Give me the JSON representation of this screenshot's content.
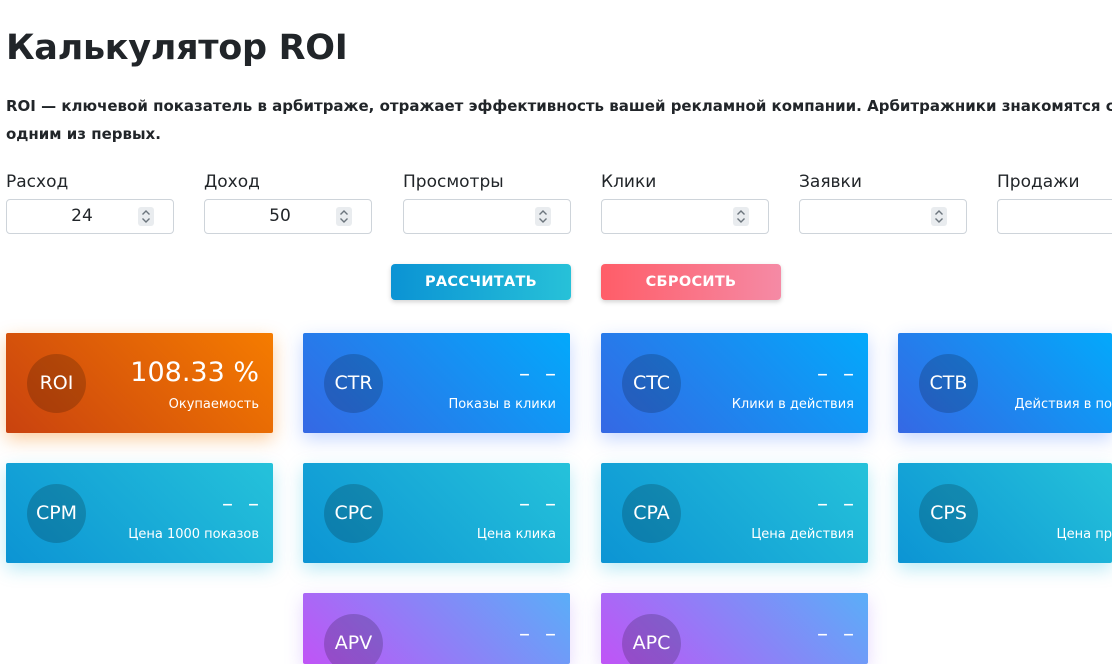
{
  "page": {
    "title": "Калькулятор ROI",
    "description_line1": "ROI — ключевой показатель в арбитраже, отражает эффективность вашей рекламной компании. Арбитражники знакомятся с этим парам",
    "description_line2": "одним из первых."
  },
  "inputs": [
    {
      "label": "Расход",
      "value": "24"
    },
    {
      "label": "Доход",
      "value": "50"
    },
    {
      "label": "Просмотры",
      "value": ""
    },
    {
      "label": "Клики",
      "value": ""
    },
    {
      "label": "Заявки",
      "value": ""
    },
    {
      "label": "Продажи",
      "value": ""
    }
  ],
  "buttons": {
    "calculate": "РАССЧИТАТЬ",
    "reset": "СБРОСИТЬ"
  },
  "metrics": [
    {
      "abbr": "ROI",
      "value": "108.33 %",
      "label": "Окупаемость",
      "color": "#f57c00"
    },
    {
      "abbr": "CTR",
      "value": "– –",
      "label": "Показы в клики",
      "color": "#03a9fb"
    },
    {
      "abbr": "CTC",
      "value": "– –",
      "label": "Клики в действия",
      "color": "#03a9fb"
    },
    {
      "abbr": "CTB",
      "value": "– –",
      "label": "Действия в по",
      "color": "#03a9fb"
    },
    {
      "abbr": "CPM",
      "value": "– –",
      "label": "Цена 1000 показов",
      "color": "#25c2da"
    },
    {
      "abbr": "CPC",
      "value": "– –",
      "label": "Цена клика",
      "color": "#25c2da"
    },
    {
      "abbr": "CPA",
      "value": "– –",
      "label": "Цена действия",
      "color": "#25c2da"
    },
    {
      "abbr": "CPS",
      "value": "– –",
      "label": "Цена пр",
      "color": "#25c2da"
    },
    {
      "abbr": "APV",
      "value": "– –",
      "label": "",
      "color": "#5aaef8"
    },
    {
      "abbr": "APC",
      "value": "– –",
      "label": "",
      "color": "#5aaef8"
    }
  ]
}
